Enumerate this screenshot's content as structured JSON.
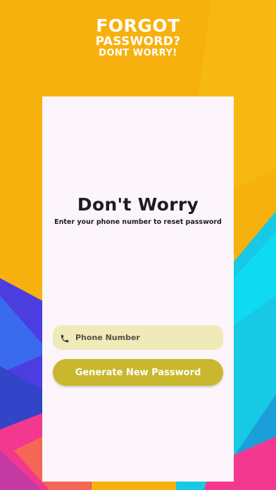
{
  "header": {
    "line1": "FORGOT",
    "line2": "PASSWORD?",
    "line3": "DONT WORRY!"
  },
  "card": {
    "title": "Don't Worry",
    "subtitle": "Enter your phone number to reset password"
  },
  "phone_field": {
    "icon": "phone-icon",
    "placeholder": "Phone Number"
  },
  "generate_button": {
    "label": "Generate New Password"
  },
  "colors": {
    "background": "#F7B10E",
    "card": "#FCF6FC",
    "field": "#F0EAB9",
    "button": "#C9B82E",
    "text": "#1E1B24"
  }
}
